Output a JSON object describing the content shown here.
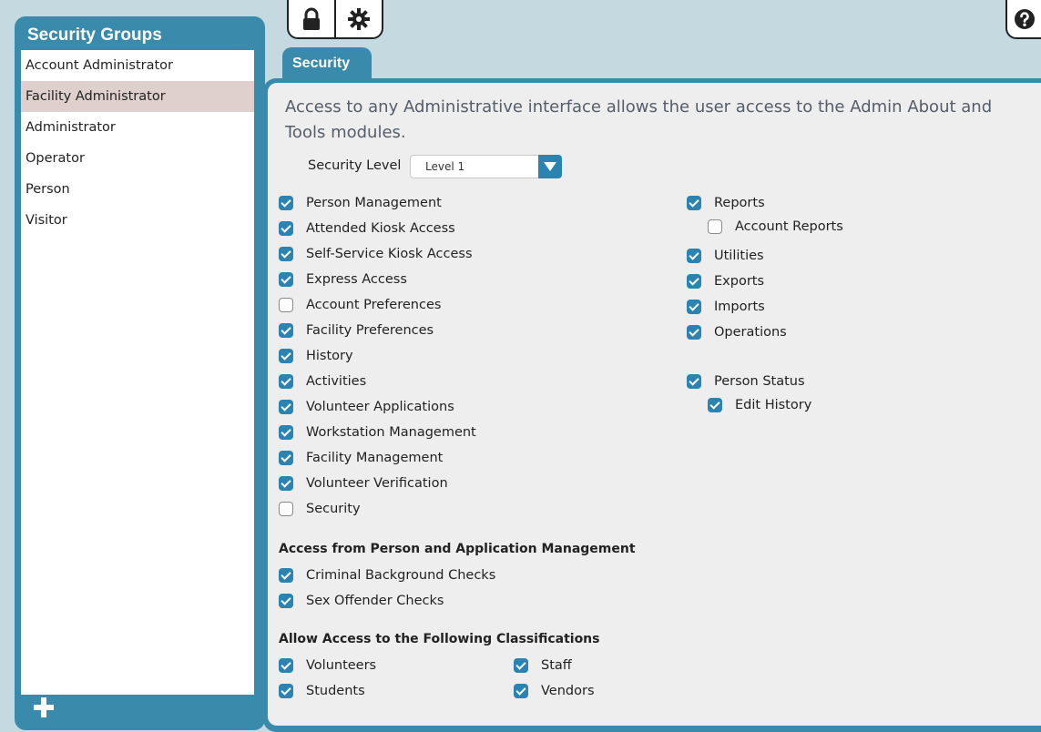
{
  "sidebar": {
    "title": "Security Groups",
    "groups": [
      {
        "label": "Account Administrator"
      },
      {
        "label": "Facility Administrator",
        "selected": true
      },
      {
        "label": "Administrator"
      },
      {
        "label": "Operator"
      },
      {
        "label": "Person"
      },
      {
        "label": "Visitor"
      }
    ]
  },
  "toolbar": {
    "icons": [
      "lock-icon",
      "gear-icon"
    ],
    "help_icon": "question-circle-icon"
  },
  "tab": {
    "label": "Security"
  },
  "content": {
    "description": "Access to any Administrative interface allows the user access to the Admin About and Tools modules.",
    "security_level": {
      "label": "Security Level",
      "value": "Level 1"
    },
    "left_permissions": [
      {
        "label": "Person Management",
        "checked": true
      },
      {
        "label": "Attended Kiosk Access",
        "checked": true
      },
      {
        "label": "Self-Service Kiosk Access",
        "checked": true
      },
      {
        "label": "Express Access",
        "checked": true
      },
      {
        "label": "Account Preferences",
        "checked": false
      },
      {
        "label": "Facility Preferences",
        "checked": true
      },
      {
        "label": "History",
        "checked": true
      },
      {
        "label": "Activities",
        "checked": true
      },
      {
        "label": "Volunteer Applications",
        "checked": true
      },
      {
        "label": "Workstation Management",
        "checked": true
      },
      {
        "label": "Facility Management",
        "checked": true
      },
      {
        "label": "Volunteer Verification",
        "checked": true
      },
      {
        "label": "Security",
        "checked": false
      }
    ],
    "right_permissions": {
      "reports": {
        "label": "Reports",
        "checked": true
      },
      "account_reports": {
        "label": "Account Reports",
        "checked": false
      },
      "utilities": {
        "label": "Utilities",
        "checked": true
      },
      "exports": {
        "label": "Exports",
        "checked": true
      },
      "imports": {
        "label": "Imports",
        "checked": true
      },
      "operations": {
        "label": "Operations",
        "checked": true
      },
      "person_status": {
        "label": "Person Status",
        "checked": true
      },
      "edit_history": {
        "label": "Edit History",
        "checked": true
      }
    },
    "person_app_section": {
      "heading": "Access from Person and Application Management",
      "items": [
        {
          "label": "Criminal Background Checks",
          "checked": true
        },
        {
          "label": "Sex Offender Checks",
          "checked": true
        }
      ]
    },
    "classifications_section": {
      "heading": "Allow Access to the Following Classifications",
      "items": [
        {
          "label": "Volunteers",
          "checked": true
        },
        {
          "label": "Staff",
          "checked": true
        },
        {
          "label": "Students",
          "checked": true
        },
        {
          "label": "Vendors",
          "checked": true
        }
      ]
    }
  },
  "colors": {
    "accent": "#3a8aab",
    "checkbox": "#2a83b1",
    "background": "#c5d9e1",
    "selected_row": "#dfd0ce"
  }
}
